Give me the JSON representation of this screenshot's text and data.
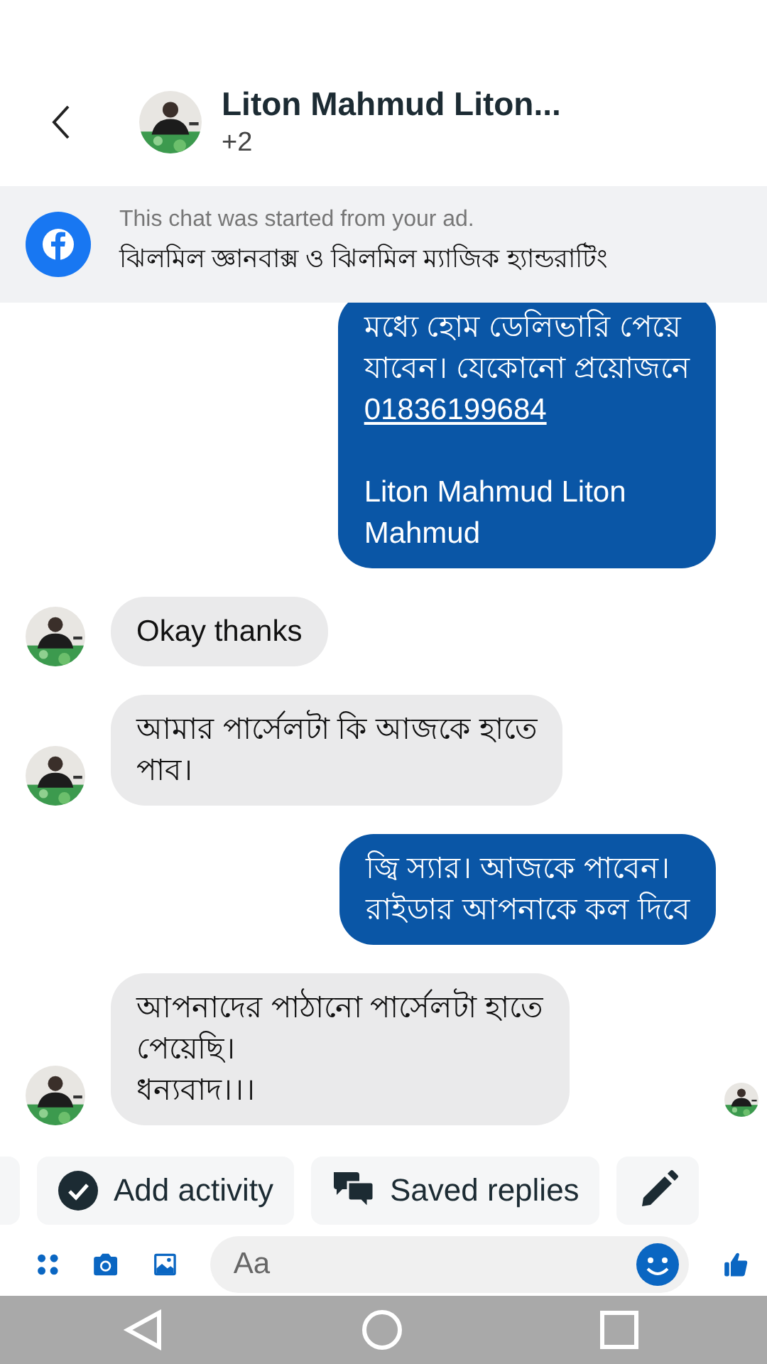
{
  "header": {
    "name": "Liton Mahmud Liton...",
    "subtitle": "+2"
  },
  "ad_banner": {
    "note": "This chat was started from your ad.",
    "ad_title": "ঝিলমিল জ্ঞানবাক্স ও ঝিলমিল ম্যাজিক হ্যান্ডরাটিং"
  },
  "messages": [
    {
      "kind": "outgoing",
      "text": "মধ্যে হোম ডেলিভারি পেয়ে\nযাবেন। যেকোনো প্রয়োজনে",
      "link": "01836199684",
      "signature": "Liton Mahmud Liton\nMahmud"
    },
    {
      "kind": "incoming",
      "text": "Okay thanks"
    },
    {
      "kind": "incoming",
      "text": "আমার পার্সেলটা কি আজকে হাতে\nপাব।"
    },
    {
      "kind": "outgoing",
      "text": "জ্বি স্যার। আজকে পাবেন।\nরাইডার আপনাকে কল দিবে"
    },
    {
      "kind": "incoming",
      "text": "আপনাদের পাঠানো পার্সেলটা হাতে\nপেয়েছি।\nধন্যবাদ।।।",
      "seen": true
    }
  ],
  "quick_replies": [
    {
      "kind": "activity",
      "label": "Add activity"
    },
    {
      "kind": "saved",
      "label": "Saved replies"
    },
    {
      "kind": "edit"
    }
  ],
  "composer": {
    "placeholder": "Aa"
  }
}
